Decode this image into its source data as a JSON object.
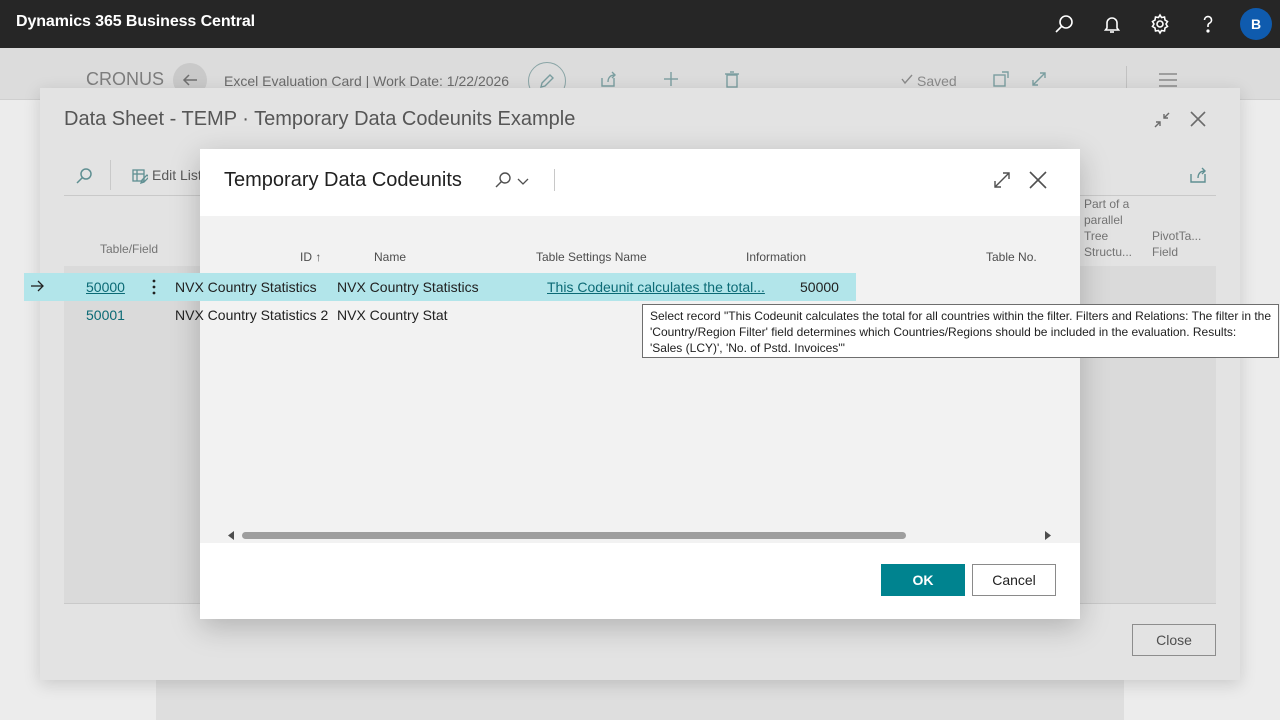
{
  "app": {
    "title": "Dynamics 365 Business Central",
    "user_initial": "B"
  },
  "background_page": {
    "company": "CRONUS",
    "title": "Excel Evaluation Card | Work Date: 1/22/2026",
    "saved_label": "Saved"
  },
  "data_sheet": {
    "title": "Data Sheet - TEMP · Temporary Data Codeunits Example",
    "edit_list_label": "Edit List",
    "col_table_field": "Table/Field",
    "col_part_parallel": "Part of a parallel Tree Structu...",
    "col_pivot": "PivotTa... Field",
    "close_label": "Close"
  },
  "dialog": {
    "title": "Temporary Data Codeunits",
    "columns": {
      "id": "ID ↑",
      "name": "Name",
      "table_settings_name": "Table Settings Name",
      "information": "Information",
      "table_no": "Table No."
    },
    "rows": [
      {
        "id": "50000",
        "name": "NVX Country Statistics",
        "table_settings_name": "NVX Country Statistics",
        "information": "This Codeunit calculates the total...",
        "table_no": "50000",
        "selected": true
      },
      {
        "id": "50001",
        "name": "NVX Country Statistics 2",
        "table_settings_name": "NVX Country Stat",
        "information": "",
        "table_no": "",
        "selected": false
      }
    ],
    "ok_label": "OK",
    "cancel_label": "Cancel"
  },
  "tooltip": {
    "text": "Select record \"This Codeunit calculates the total for all countries within the filter. Filters and Relations: The filter in the 'Country/Region Filter' field determines which Countries/Regions should be included in the evaluation. Results: 'Sales (LCY)', 'No. of Pstd. Invoices'\""
  },
  "icons": {
    "search": "search-icon",
    "notifications": "bell-icon",
    "settings": "gear-icon",
    "help": "help-icon"
  },
  "colors": {
    "appbar": "#262626",
    "accent": "#00838f",
    "selected_row": "#b2e5ea",
    "link": "#0b6a75"
  }
}
